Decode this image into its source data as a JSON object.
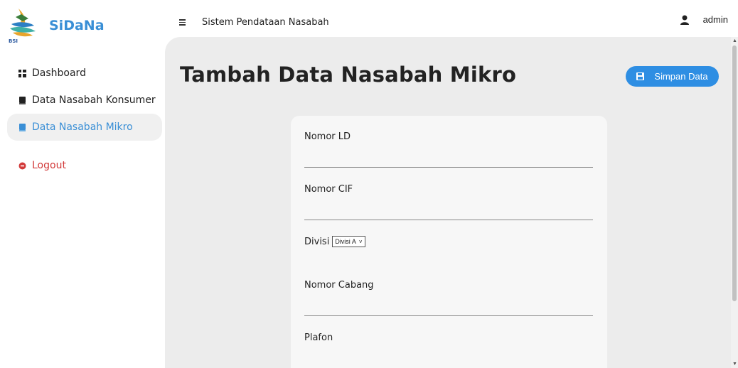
{
  "brand": {
    "name": "SiDaNa",
    "logo_text": "BSI"
  },
  "topbar": {
    "menu_icon": "hamburger-icon",
    "title": "Sistem Pendataan Nasabah"
  },
  "user": {
    "icon": "user-icon",
    "name": "admin"
  },
  "sidebar": {
    "items": [
      {
        "label": "Dashboard",
        "icon": "grid-icon",
        "active": false
      },
      {
        "label": "Data Nasabah Konsumer",
        "icon": "book-icon",
        "active": false
      },
      {
        "label": "Data Nasabah Mikro",
        "icon": "book-icon",
        "active": true
      },
      {
        "label": "Logout",
        "icon": "logout-icon",
        "active": false
      }
    ]
  },
  "page": {
    "title": "Tambah Data Nasabah Mikro",
    "save_button": {
      "label": "Simpan Data",
      "icon": "save-icon"
    }
  },
  "form": {
    "fields": [
      {
        "label": "Nomor LD",
        "value": ""
      },
      {
        "label": "Nomor CIF",
        "value": ""
      },
      {
        "label": "Divisi",
        "selected": "Divisi A"
      },
      {
        "label": "Nomor Cabang",
        "value": ""
      },
      {
        "label": "Plafon",
        "value": ""
      }
    ]
  },
  "colors": {
    "accent": "#2e8ee3",
    "brand": "#3a8fd6",
    "logout": "#d23a3a",
    "main_bg": "#ececec",
    "card_bg": "#f7f7f7"
  }
}
